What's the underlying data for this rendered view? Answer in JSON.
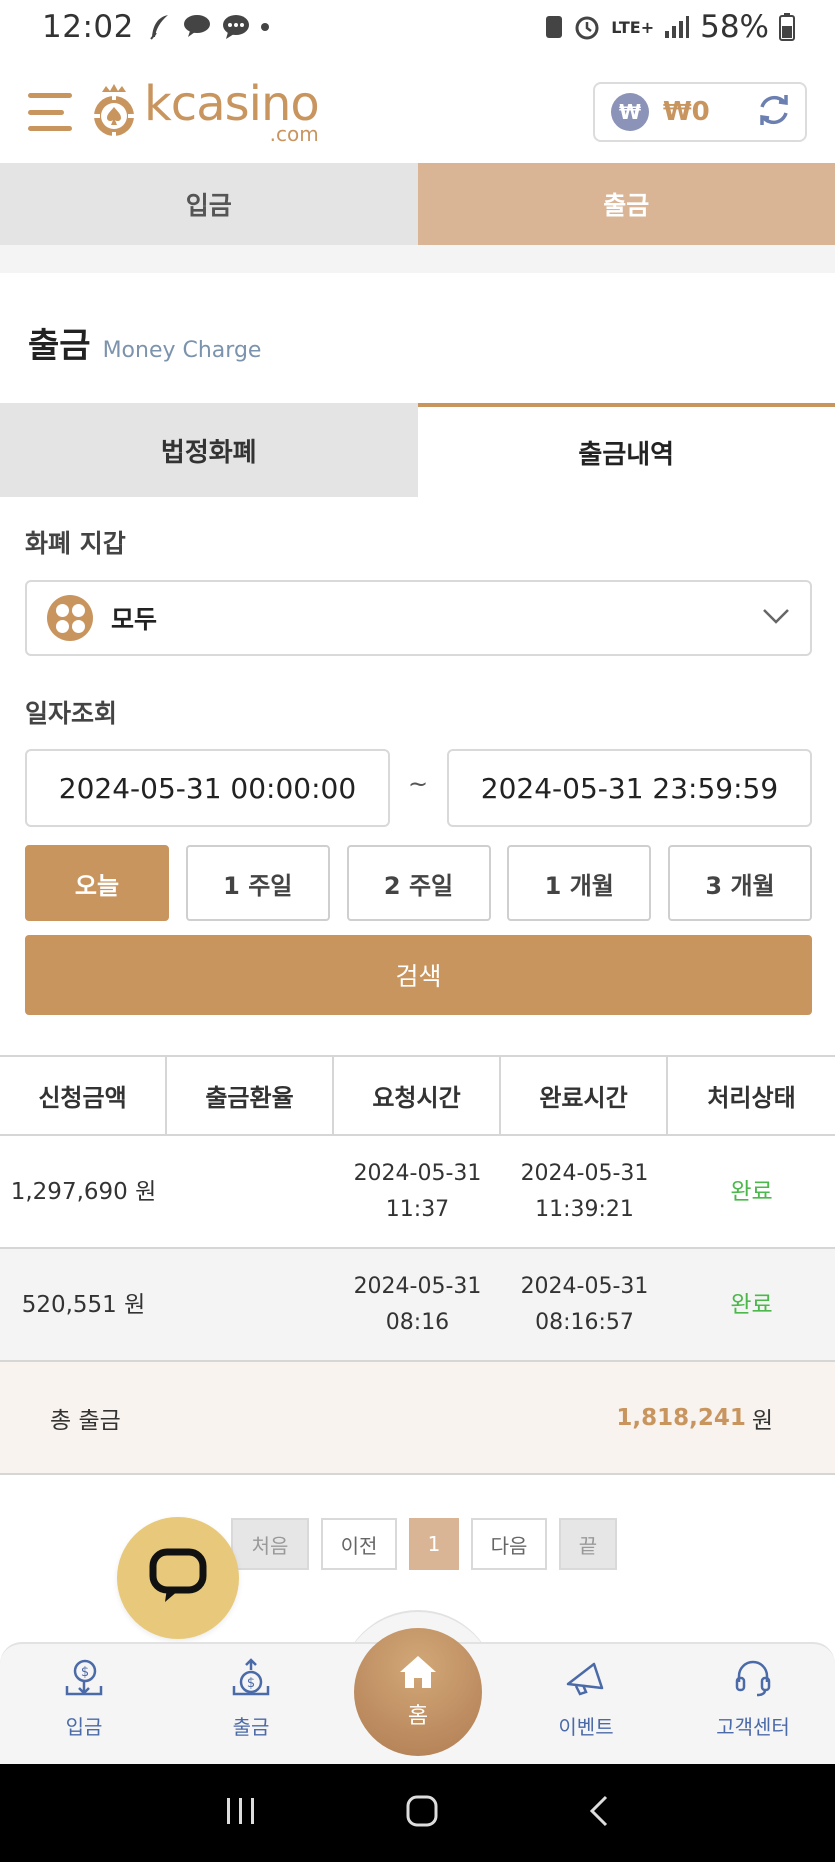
{
  "status_bar": {
    "time": "12:02",
    "network": "LTE+",
    "battery": "58%"
  },
  "header": {
    "logo_main": "kcasino",
    "logo_sub": ".com",
    "wallet_symbol": "₩",
    "wallet_amount": "₩0"
  },
  "top_tabs": [
    {
      "label": "입금",
      "active": false
    },
    {
      "label": "출금",
      "active": true
    }
  ],
  "section": {
    "title": "출금",
    "subtitle": "Money Charge"
  },
  "sub_tabs": [
    {
      "label": "법정화폐",
      "active": false
    },
    {
      "label": "출금내역",
      "active": true
    }
  ],
  "wallet_filter": {
    "label": "화폐 지갑",
    "selected": "모두"
  },
  "date_filter": {
    "label": "일자조회",
    "start": "2024-05-31 00:00:00",
    "separator": "~",
    "end": "2024-05-31 23:59:59"
  },
  "periods": [
    {
      "label": "오늘",
      "active": true
    },
    {
      "label": "1 주일",
      "active": false
    },
    {
      "label": "2 주일",
      "active": false
    },
    {
      "label": "1 개월",
      "active": false
    },
    {
      "label": "3 개월",
      "active": false
    }
  ],
  "search_label": "검색",
  "table": {
    "headers": [
      "신청금액",
      "출금환율",
      "요청시간",
      "완료시간",
      "처리상태"
    ],
    "rows": [
      {
        "amount": "1,297,690 원",
        "rate": "",
        "request_date": "2024-05-31",
        "request_time": "11:37",
        "complete_date": "2024-05-31",
        "complete_time": "11:39:21",
        "status": "완료"
      },
      {
        "amount": "520,551 원",
        "rate": "",
        "request_date": "2024-05-31",
        "request_time": "08:16",
        "complete_date": "2024-05-31",
        "complete_time": "08:16:57",
        "status": "완료"
      }
    ],
    "total_label": "총 출금",
    "total_value": "1,818,241",
    "total_unit": "원"
  },
  "pagination": {
    "first": "처음",
    "prev": "이전",
    "current": "1",
    "next": "다음",
    "last": "끝"
  },
  "bottom_nav": {
    "deposit": "입금",
    "withdraw": "출금",
    "home": "홈",
    "event": "이벤트",
    "support": "고객센터"
  },
  "colors": {
    "accent": "#c9955f",
    "tab_active": "#d9b595",
    "status_done": "#4cb84c",
    "nav_text": "#4b6aa8",
    "chat_fab": "#e8c97b"
  }
}
